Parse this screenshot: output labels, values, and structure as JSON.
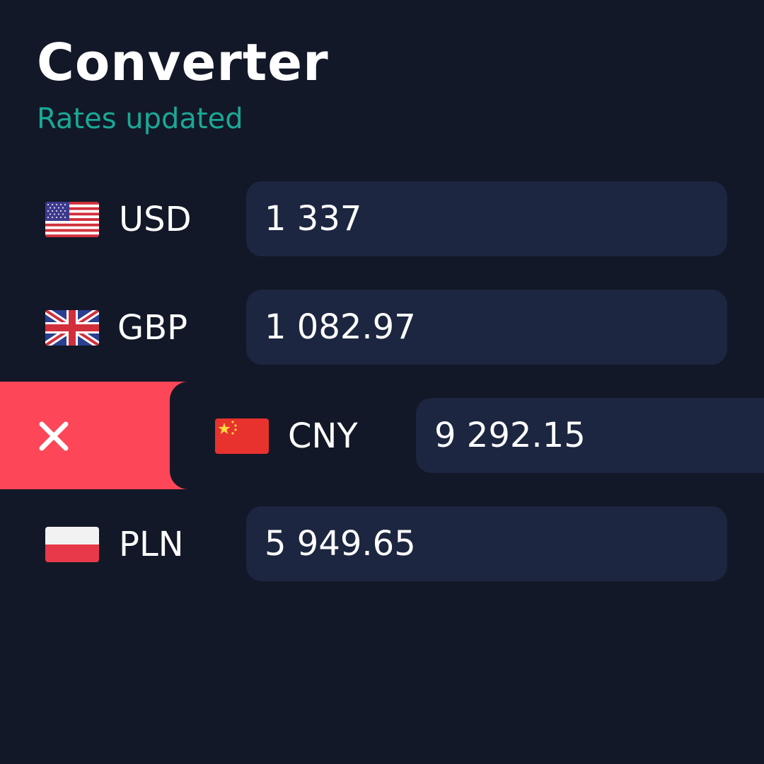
{
  "header": {
    "title": "Converter",
    "status": "Rates updated"
  },
  "currencies": [
    {
      "code": "USD",
      "amount": "1 337",
      "flag_icon": "us-flag-icon"
    },
    {
      "code": "GBP",
      "amount": "1 082.97",
      "flag_icon": "uk-flag-icon"
    },
    {
      "code": "CNY",
      "amount": "9 292.15",
      "flag_icon": "china-flag-icon",
      "swiped": true
    },
    {
      "code": "PLN",
      "amount": "5 949.65",
      "flag_icon": "poland-flag-icon"
    }
  ],
  "swipe_action": {
    "icon": "close-icon",
    "color": "#fd4658"
  },
  "colors": {
    "background": "#121827",
    "field": "#1d2640",
    "accent": "#1aa896",
    "delete": "#fd4658"
  }
}
